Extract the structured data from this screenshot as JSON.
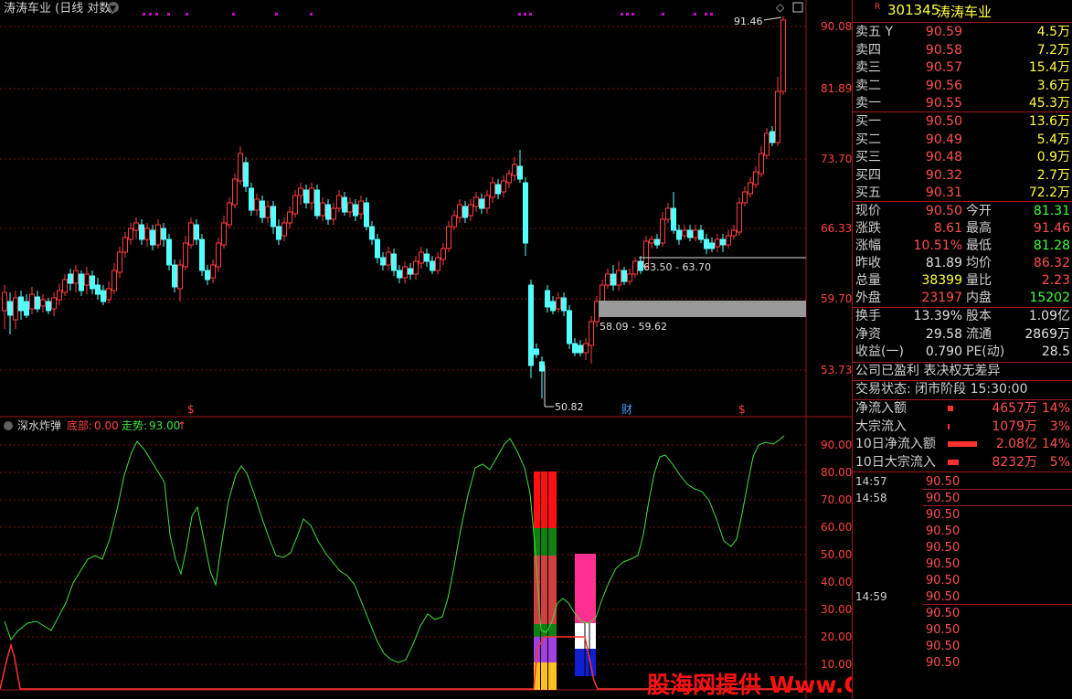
{
  "chart_title": "涛涛车业 (日线 对数)",
  "price_axis": [
    "90.08",
    "81.89",
    "73.70",
    "66.33",
    "59.70",
    "53.73"
  ],
  "high_label": "91.46",
  "low_label": "50.82",
  "zone_upper_label": "63.50 - 63.70",
  "zone_lower_label": "58.09 - 59.62",
  "event_markers": [
    "$",
    "财",
    "$"
  ],
  "indicator": {
    "name": "深水炸弹",
    "bottom_label": "底部:",
    "bottom_value": "0.00",
    "trend_label": "走势:",
    "trend_value": "93.00"
  },
  "osc_axis": [
    "90.00",
    "80.00",
    "70.00",
    "60.00",
    "50.00",
    "40.00",
    "30.00",
    "20.00",
    "10.00"
  ],
  "colors": {
    "up": "#ff3b3b",
    "down": "#54ffff",
    "trend": "#3ee03e",
    "grid": "#7a1010",
    "axis": "#ff4040"
  },
  "quote": {
    "flag": "R",
    "code": "301345",
    "name": "涛涛车业",
    "asks": [
      {
        "label": "卖五",
        "mark": "Y",
        "price": "90.59",
        "vol": "4.5",
        "unit": "万"
      },
      {
        "label": "卖四",
        "price": "90.58",
        "vol": "7.2",
        "unit": "万"
      },
      {
        "label": "卖三",
        "price": "90.57",
        "vol": "15.4",
        "unit": "万"
      },
      {
        "label": "卖二",
        "price": "90.56",
        "vol": "3.6",
        "unit": "万"
      },
      {
        "label": "卖一",
        "price": "90.55",
        "vol": "45.3",
        "unit": "万"
      }
    ],
    "bids": [
      {
        "label": "买一",
        "price": "90.50",
        "vol": "13.6",
        "unit": "万"
      },
      {
        "label": "买二",
        "price": "90.49",
        "vol": "5.4",
        "unit": "万"
      },
      {
        "label": "买三",
        "price": "90.48",
        "vol": "0.9",
        "unit": "万"
      },
      {
        "label": "买四",
        "price": "90.32",
        "vol": "2.7",
        "unit": "万"
      },
      {
        "label": "买五",
        "price": "90.31",
        "vol": "72.2",
        "unit": "万"
      }
    ],
    "stats": [
      {
        "l1": "现价",
        "v1": "90.50",
        "l2": "今开",
        "v2": "81.31",
        "c2": "#40ff40"
      },
      {
        "l1": "涨跌",
        "v1": "8.61",
        "l2": "最高",
        "v2": "91.46",
        "c2": "#ff5050"
      },
      {
        "l1": "涨幅",
        "v1": "10.51%",
        "l2": "最低",
        "v2": "81.28",
        "c2": "#40ff40"
      },
      {
        "l1": "昨收",
        "v1": "81.89",
        "l2": "均价",
        "v2": "86.32",
        "c2": "#ff5050",
        "c1": "#e0e0e0"
      },
      {
        "l1": "总量",
        "v1": "38399",
        "l2": "量比",
        "v2": "2.23",
        "c2": "#ff5050",
        "c1": "#ffff40"
      },
      {
        "l1": "外盘",
        "v1": "23197",
        "l2": "内盘",
        "v2": "15202",
        "c2": "#40ff40"
      }
    ],
    "stats2": [
      {
        "l1": "换手",
        "v1": "13.39%",
        "l2": "股本",
        "v2": "1.09亿"
      },
      {
        "l1": "净资",
        "v1": "29.58",
        "l2": "流通",
        "v2": "2869万"
      },
      {
        "l1": "收益(一)",
        "v1": "0.790",
        "l2": "PE(动)",
        "v2": "28.5"
      }
    ],
    "notice": "公司已盈利 表决权无差异",
    "status": "交易状态: 闭市阶段 15:30:00",
    "flows": [
      {
        "label": "净流入额",
        "value": "4657万",
        "pct": "14%"
      },
      {
        "label": "大宗流入",
        "value": "1079万",
        "pct": "3%"
      },
      {
        "label": "10日净流入额",
        "value": "2.08亿",
        "pct": "14%"
      },
      {
        "label": "10日大宗流入",
        "value": "8232万",
        "pct": "5%"
      }
    ],
    "ticks": [
      {
        "time": "14:57",
        "price": "90.50"
      },
      {
        "time": "14:58",
        "price": "90.50"
      },
      {
        "time": "",
        "price": "90.50"
      },
      {
        "time": "",
        "price": "90.50"
      },
      {
        "time": "",
        "price": "90.50"
      },
      {
        "time": "",
        "price": "90.50"
      },
      {
        "time": "",
        "price": "90.50"
      },
      {
        "time": "14:59",
        "price": "90.50"
      },
      {
        "time": "",
        "price": "90.50"
      },
      {
        "time": "",
        "price": "90.50"
      },
      {
        "time": "",
        "price": "90.50"
      },
      {
        "time": "",
        "price": "90.50"
      }
    ]
  },
  "watermark": "股海网提供 Www.Guhai.Com.CN"
}
